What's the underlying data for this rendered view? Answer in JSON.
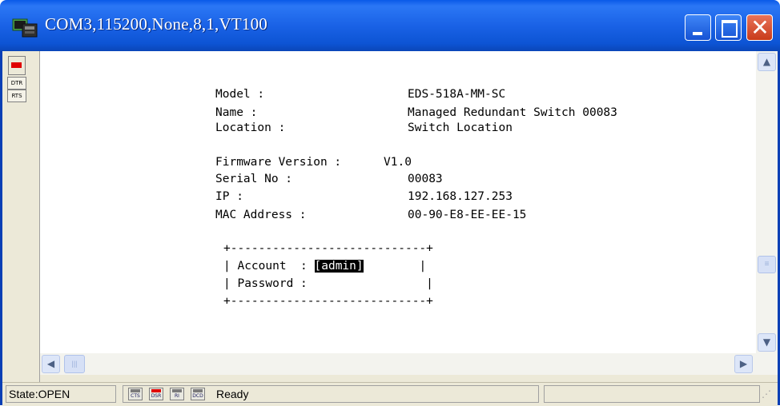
{
  "window": {
    "title": "COM3,115200,None,8,1,VT100"
  },
  "sidebar": {
    "pins": [
      "DTR",
      "RTS"
    ]
  },
  "terminal": {
    "info": [
      {
        "label": "Model :",
        "value": "EDS-518A-MM-SC"
      },
      {
        "label": "Name :",
        "value": "Managed Redundant Switch 00083"
      },
      {
        "label": "Location :",
        "value": "Switch Location"
      },
      {
        "label": "Firmware Version :",
        "value": "V1.0"
      },
      {
        "label": "Serial No :",
        "value": "00083"
      },
      {
        "label": "IP :",
        "value": "192.168.127.253"
      },
      {
        "label": "MAC Address :",
        "value": "00-90-E8-EE-EE-15"
      }
    ],
    "login_box": {
      "border": "+----------------------------+",
      "account_prefix": "| Account  : ",
      "account_value": "[admin]",
      "account_suffix": "        |",
      "password_line": "| Password :                 |"
    }
  },
  "statusbar": {
    "state": "State:OPEN",
    "signals": [
      {
        "name": "CTS",
        "on": false
      },
      {
        "name": "DSR",
        "on": true
      },
      {
        "name": "RI",
        "on": false
      },
      {
        "name": "DCD",
        "on": false
      }
    ],
    "status_text": "Ready"
  },
  "colors": {
    "titlebar": "#0a59e8",
    "lamp_on": "#e00000"
  }
}
